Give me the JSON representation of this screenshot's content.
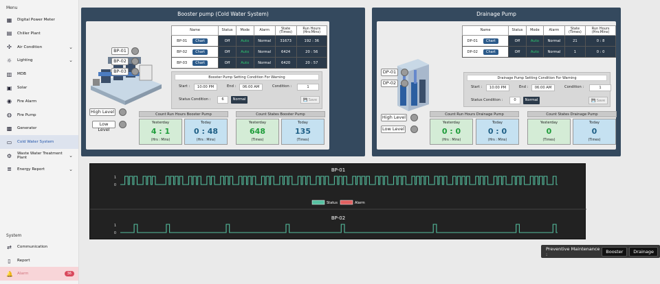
{
  "sidebar": {
    "menu_heading": "Menu",
    "system_heading": "System",
    "items": [
      {
        "label": "Digital Power Meter",
        "icon": "power-meter-icon"
      },
      {
        "label": "Chiller Plant",
        "icon": "chiller-icon"
      },
      {
        "label": "Air Condition",
        "icon": "fan-icon",
        "expand": true
      },
      {
        "label": "Lighting",
        "icon": "bulb-icon",
        "expand": true
      },
      {
        "label": "MDB",
        "icon": "mdb-icon"
      },
      {
        "label": "Solar",
        "icon": "solar-icon"
      },
      {
        "label": "Fire Alarm",
        "icon": "fire-alarm-icon"
      },
      {
        "label": "Fire Pump",
        "icon": "fire-pump-icon"
      },
      {
        "label": "Generator",
        "icon": "generator-icon"
      },
      {
        "label": "Cold Water System",
        "icon": "water-icon",
        "active": true
      },
      {
        "label": "Waste Water Treatment Plant",
        "icon": "wastewater-icon",
        "expand": true
      },
      {
        "label": "Energy Report",
        "icon": "report-icon",
        "expand": true
      }
    ],
    "system_items": [
      {
        "label": "Communication",
        "icon": "communication-icon"
      },
      {
        "label": "Report",
        "icon": "document-icon"
      }
    ],
    "alarm": {
      "label": "Alarm",
      "count": "36",
      "icon": "bell-icon"
    }
  },
  "booster": {
    "title": "Booster pump (Cold Water System)",
    "headers": [
      "Name",
      "Status",
      "Mode",
      "Alarm",
      "State\n(Times)",
      "Run Hours\n(Hrs:Mins)"
    ],
    "rows": [
      {
        "name": "BP-01",
        "chart": "Chart",
        "status": "Off",
        "mode": "Auto",
        "alarm": "Normal",
        "state": "31673",
        "hours": "192 : 36"
      },
      {
        "name": "BP-02",
        "chart": "Chart",
        "status": "Off",
        "mode": "Auto",
        "alarm": "Normal",
        "state": "6424",
        "hours": "20 : 56"
      },
      {
        "name": "BP-03",
        "chart": "Chart",
        "status": "Off",
        "mode": "Auto",
        "alarm": "Normal",
        "state": "6420",
        "hours": "20 : 57"
      }
    ],
    "pump_labels": [
      "BP-01",
      "BP-02",
      "BP-03"
    ],
    "cond": {
      "title": "Booster Pump Setting Condition For Warning",
      "start_label": "Start",
      "start": "10:00 PM",
      "end_label": "End",
      "end": "06:00 AM",
      "condition_label": "Condition",
      "condition": "1",
      "status_label": "Status Condition",
      "status_value": "6",
      "normal": "Normal",
      "save": "Save"
    },
    "high": "High Level",
    "low": "Low Level",
    "hours_head": "Count Run Hours Booster Pump",
    "states_head": "Count States Booster Pump",
    "boxes": [
      {
        "t": "Yesterday",
        "v": "4 : 1",
        "u": "(Hrs : Mins)"
      },
      {
        "t": "Today",
        "v": "0 : 48",
        "u": "(Hrs : Mins)"
      },
      {
        "t": "Yesterday",
        "v": "648",
        "u": "(Times)"
      },
      {
        "t": "Today",
        "v": "135",
        "u": "(Times)"
      }
    ]
  },
  "drain": {
    "title": "Drainage Pump",
    "headers": [
      "Name",
      "Status",
      "Mode",
      "Alarm",
      "State\n(Times)",
      "Run Hours\n(Hrs:Mins)"
    ],
    "rows": [
      {
        "name": "DP-01",
        "chart": "Chart",
        "status": "Off",
        "mode": "Auto",
        "alarm": "Normal",
        "state": "21",
        "hours": "0 : 8"
      },
      {
        "name": "DP-02",
        "chart": "Chart",
        "status": "Off",
        "mode": "Auto",
        "alarm": "Normal",
        "state": "1",
        "hours": "0 : 0"
      }
    ],
    "pump_labels": [
      "DP-01",
      "DP-02"
    ],
    "cond": {
      "title": "Drainage Pump Setting Condition For Warning",
      "start_label": "Start",
      "start": "10:00 PM",
      "end_label": "End",
      "end": "06:00 AM",
      "condition_label": "Condition",
      "condition": "1",
      "status_label": "Status Condition",
      "status_value": "0",
      "normal": "Normal",
      "save": "Save"
    },
    "high": "High Level",
    "low": "Low Level",
    "hours_head": "Count Run Hours Drainage Pump",
    "states_head": "Count States Drainage Pump",
    "boxes": [
      {
        "t": "Yesterday",
        "v": "0 : 0",
        "u": "(Hrs : Mins)"
      },
      {
        "t": "Today",
        "v": "0 : 0",
        "u": "(Hrs : Mins)"
      },
      {
        "t": "Yesterday",
        "v": "0",
        "u": "(Times)"
      },
      {
        "t": "Today",
        "v": "0",
        "u": "(Times)"
      }
    ]
  },
  "preventive": {
    "label": "Preventive Maintenance :",
    "buttons": [
      "Booster",
      "Drainage"
    ]
  },
  "chart_data": [
    {
      "type": "line",
      "title": "BP-01",
      "yticks": [
        "1",
        "0"
      ],
      "legend": [
        "Status",
        "Alarm"
      ],
      "colors": {
        "Status": "#55c0a0",
        "Alarm": "#e06060"
      },
      "pulses": [
        0,
        1,
        1,
        1,
        0,
        1,
        1,
        1,
        0,
        0,
        1,
        1,
        1,
        1,
        0,
        1,
        1,
        1,
        0,
        1,
        1,
        0,
        1,
        1,
        1,
        0,
        1,
        1,
        1,
        1,
        0,
        1,
        1,
        1,
        0,
        1,
        1,
        1,
        0,
        1,
        1,
        1,
        0,
        1,
        1,
        1,
        0,
        1,
        1,
        1,
        0,
        1,
        1,
        1,
        1,
        0,
        1,
        1,
        1,
        0,
        1,
        1,
        1,
        0,
        1,
        1,
        1,
        1,
        0,
        1,
        1,
        1,
        0,
        1,
        1,
        1,
        1,
        0,
        1,
        1,
        1,
        0,
        1,
        1,
        1,
        0,
        1,
        1,
        1,
        0,
        1,
        1,
        1,
        1,
        0,
        1
      ]
    },
    {
      "type": "line",
      "title": "BP-02",
      "yticks": [
        "1",
        "0"
      ],
      "pulses": [
        0,
        0,
        0,
        1,
        0,
        0,
        0,
        0,
        0,
        0,
        1,
        0,
        0,
        0,
        0,
        0,
        0,
        0,
        0,
        0,
        0,
        0,
        0,
        1,
        0,
        0,
        0,
        0,
        0,
        0,
        0,
        0,
        0,
        0,
        0,
        0,
        1,
        0,
        0,
        0,
        0,
        0,
        0,
        0,
        0,
        0,
        0,
        0,
        1,
        0,
        0,
        0,
        0,
        0,
        0,
        0,
        0,
        0,
        0,
        0,
        0,
        0,
        0,
        0,
        0,
        0,
        0,
        0,
        1,
        0,
        0,
        0,
        0,
        0,
        0,
        0,
        0,
        0,
        0,
        0,
        0,
        0,
        0,
        0,
        0,
        0,
        1,
        0,
        0,
        0,
        0,
        0,
        0,
        0,
        1
      ]
    }
  ]
}
